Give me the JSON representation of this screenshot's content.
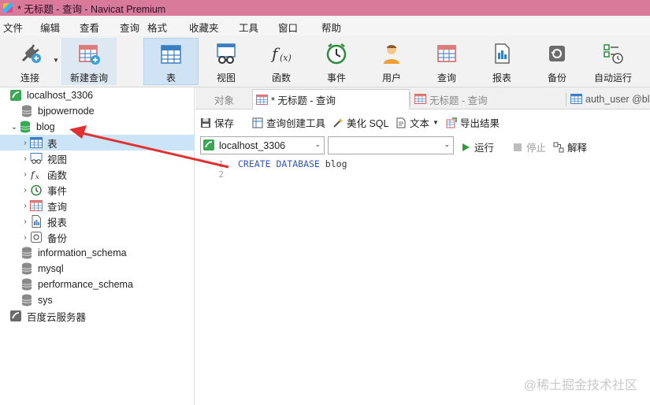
{
  "window": {
    "title": "* 无标题 - 查询 - Navicat Premium"
  },
  "menu": [
    "文件",
    "编辑",
    "查看",
    "查询",
    "格式",
    "收藏夹",
    "工具",
    "窗口",
    "帮助"
  ],
  "toolbar": {
    "buttons": [
      {
        "label": "连接",
        "icon": "plug-icon"
      },
      {
        "label": "新建查询",
        "icon": "new-query-icon"
      },
      {
        "label": "表",
        "icon": "table-icon"
      },
      {
        "label": "视图",
        "icon": "view-icon"
      },
      {
        "label": "函数",
        "icon": "function-icon"
      },
      {
        "label": "事件",
        "icon": "clock-icon"
      },
      {
        "label": "用户",
        "icon": "user-icon"
      },
      {
        "label": "查询",
        "icon": "query-icon"
      },
      {
        "label": "报表",
        "icon": "report-icon"
      },
      {
        "label": "备份",
        "icon": "backup-icon"
      },
      {
        "label": "自动运行",
        "icon": "autorun-icon"
      }
    ]
  },
  "tree": [
    {
      "label": "localhost_3306"
    },
    {
      "label": "bjpowernode"
    },
    {
      "label": "blog"
    },
    {
      "label": "表"
    },
    {
      "label": "视图"
    },
    {
      "label": "函数"
    },
    {
      "label": "事件"
    },
    {
      "label": "查询"
    },
    {
      "label": "报表"
    },
    {
      "label": "备份"
    },
    {
      "label": "information_schema"
    },
    {
      "label": "mysql"
    },
    {
      "label": "performance_schema"
    },
    {
      "label": "sys"
    },
    {
      "label": "百度云服务器"
    }
  ],
  "tabs": [
    {
      "label": "对象"
    },
    {
      "label": "* 无标题 - 查询"
    },
    {
      "label": "无标题 - 查询"
    },
    {
      "label": "auth_user @bl"
    }
  ],
  "query_toolbar": {
    "save": "保存",
    "builder": "查询创建工具",
    "beautify": "美化 SQL",
    "text": "文本",
    "export": "导出结果"
  },
  "connection": {
    "selected": "localhost_3306",
    "database": "",
    "run": "运行",
    "stop": "停止",
    "explain": "解释"
  },
  "editor": {
    "line_numbers": [
      "1",
      "2"
    ],
    "code_keyword": "CREATE DATABASE",
    "code_identifier": "blog"
  },
  "watermark": "@稀土掘金技术社区",
  "colors": {
    "titlebar": "#d97a9a",
    "selection": "#cce4f7",
    "keyword": "#2d55c8",
    "db_green": "#3aa757",
    "arrow": "#e03030"
  }
}
